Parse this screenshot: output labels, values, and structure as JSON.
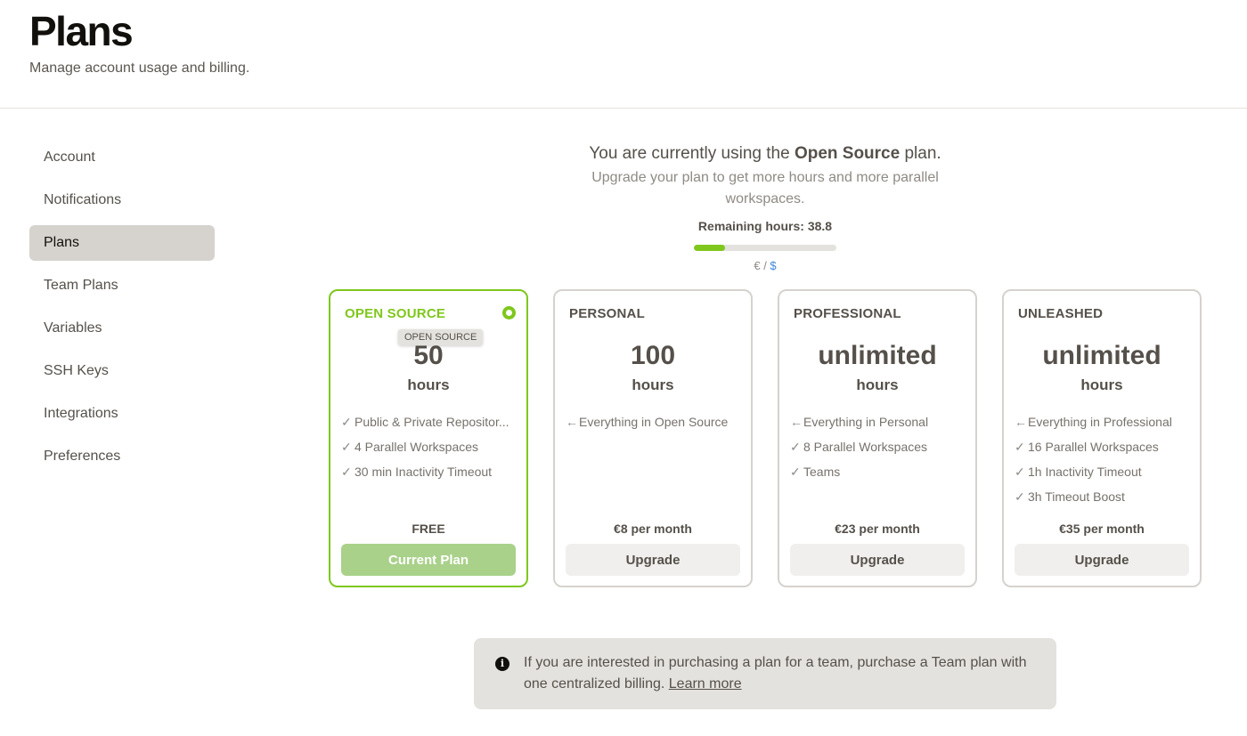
{
  "header": {
    "title": "Plans",
    "subtitle": "Manage account usage and billing."
  },
  "sidebar": {
    "items": [
      {
        "label": "Account"
      },
      {
        "label": "Notifications"
      },
      {
        "label": "Plans"
      },
      {
        "label": "Team Plans"
      },
      {
        "label": "Variables"
      },
      {
        "label": "SSH Keys"
      },
      {
        "label": "Integrations"
      },
      {
        "label": "Preferences"
      }
    ],
    "active_item": "Plans"
  },
  "intro": {
    "line_prefix": "You are currently using the ",
    "current_plan": "Open Source",
    "line_suffix": " plan.",
    "subtext": "Upgrade your plan to get more hours and more parallel workspaces.",
    "remaining_label": "Remaining hours: 38.8",
    "remaining_fraction": 0.22,
    "currency_eur": "€",
    "currency_sep": " / ",
    "currency_usd": "$"
  },
  "plans": [
    {
      "name": "OPEN SOURCE",
      "tooltip": "OPEN SOURCE",
      "hours": "50",
      "unit": "hours",
      "features": [
        {
          "icon": "✓",
          "text": "Public & Private Repositor..."
        },
        {
          "icon": "✓",
          "text": "4 Parallel Workspaces"
        },
        {
          "icon": "✓",
          "text": "30 min Inactivity Timeout"
        }
      ],
      "price": "FREE",
      "button": "Current Plan"
    },
    {
      "name": "PERSONAL",
      "hours": "100",
      "unit": "hours",
      "features": [
        {
          "icon": "←",
          "text": "Everything in Open Source"
        }
      ],
      "price": "€8 per month",
      "button": "Upgrade"
    },
    {
      "name": "PROFESSIONAL",
      "hours": "unlimited",
      "unit": "hours",
      "features": [
        {
          "icon": "←",
          "text": "Everything in Personal"
        },
        {
          "icon": "✓",
          "text": "8 Parallel Workspaces"
        },
        {
          "icon": "✓",
          "text": "Teams"
        }
      ],
      "price": "€23 per month",
      "button": "Upgrade"
    },
    {
      "name": "UNLEASHED",
      "hours": "unlimited",
      "unit": "hours",
      "features": [
        {
          "icon": "←",
          "text": "Everything in Professional"
        },
        {
          "icon": "✓",
          "text": "16 Parallel Workspaces"
        },
        {
          "icon": "✓",
          "text": "1h Inactivity Timeout"
        },
        {
          "icon": "✓",
          "text": "3h Timeout Boost"
        }
      ],
      "price": "€35 per month",
      "button": "Upgrade"
    }
  ],
  "info": {
    "icon": "info-icon",
    "text": "If you are interested in purchasing a plan for a team, purchase a Team plan with one centralized billing. ",
    "link": "Learn more"
  },
  "colors": {
    "accent_green": "#7fc71c",
    "current_button": "#a9d18a",
    "usd_link": "#3e86d9"
  }
}
